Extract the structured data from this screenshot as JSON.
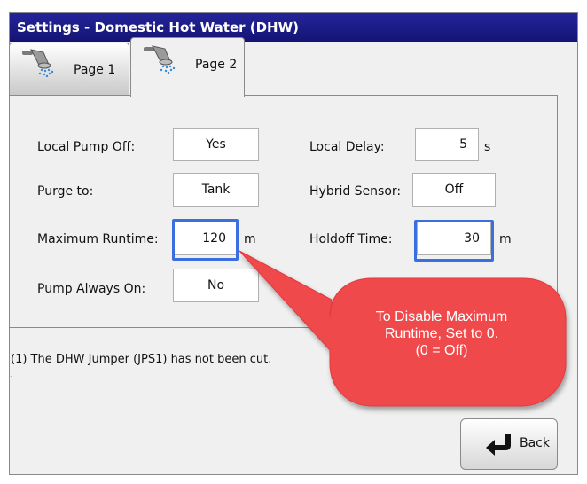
{
  "window": {
    "title": "Settings - Domestic Hot Water (DHW)"
  },
  "tabs": [
    {
      "label": "Page 1",
      "icon": "shower-head-icon"
    },
    {
      "label": "Page 2",
      "icon": "shower-head-icon"
    }
  ],
  "fields": {
    "local_pump_off": {
      "label": "Local Pump Off:",
      "value": "Yes"
    },
    "purge_to": {
      "label": "Purge to:",
      "value": "Tank"
    },
    "maximum_runtime": {
      "label": "Maximum Runtime:",
      "value": "120",
      "unit": "m"
    },
    "pump_always_on": {
      "label": "Pump Always On:",
      "value": "No"
    },
    "local_delay": {
      "label": "Local Delay:",
      "value": "5",
      "unit": "s"
    },
    "hybrid_sensor": {
      "label": "Hybrid Sensor:",
      "value": "Off"
    },
    "holdoff_time": {
      "label": "Holdoff Time:",
      "value": "30",
      "unit": "m"
    }
  },
  "note": "(1) The DHW Jumper (JPS1) has not been cut.",
  "note_marker": ".",
  "callout": {
    "line1": "To Disable Maximum",
    "line2": "Runtime, Set to 0.",
    "line3": "(0 = Off)"
  },
  "back_button": {
    "label": "Back"
  },
  "colors": {
    "title_bar": "#1c1c86",
    "highlight_border": "#3b6fe0",
    "callout_fill": "#f0484c"
  }
}
